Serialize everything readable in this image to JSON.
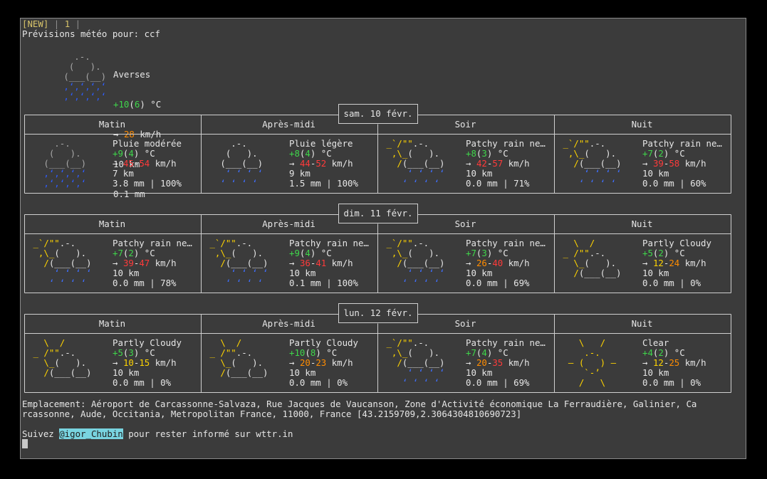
{
  "tabbar": {
    "tab_new": "[NEW]",
    "tab_num": "1"
  },
  "header": "Prévisions météo pour: ccf",
  "current": {
    "desc": "Averses",
    "temp": "+10",
    "feels": "6",
    "temp_unit": "°C",
    "wind_arrow": "→",
    "wind": "28",
    "wind_unit": "km/h",
    "visibility": "10 km",
    "precip": "0.1 mm",
    "icon": "rain-showers-icon"
  },
  "period_labels": [
    "Matin",
    "Après-midi",
    "Soir",
    "Nuit"
  ],
  "days": [
    {
      "date": "sam. 10 févr.",
      "periods": [
        {
          "icon": "rain-showers-icon",
          "desc": "Pluie modérée",
          "temp": "+9",
          "feels": "4",
          "wind_lo": "45",
          "wind_hi": "54",
          "wind_lo_color": "#ff3a3a",
          "wind_hi_color": "#ff3a3a",
          "visibility": "7 km",
          "precip": "3.8 mm | 100%"
        },
        {
          "icon": "light-rain-icon",
          "desc": "Pluie légère",
          "temp": "+8",
          "feels": "4",
          "wind_lo": "44",
          "wind_hi": "52",
          "wind_lo_color": "#ff3a3a",
          "wind_hi_color": "#ff3a3a",
          "visibility": "9 km",
          "precip": "1.5 mm | 100%"
        },
        {
          "icon": "patchy-rain-icon",
          "desc": "Patchy rain ne…",
          "temp": "+8",
          "feels": "3",
          "wind_lo": "42",
          "wind_hi": "57",
          "wind_lo_color": "#ff3a3a",
          "wind_hi_color": "#ff3a3a",
          "visibility": "10 km",
          "precip": "0.0 mm | 71%"
        },
        {
          "icon": "patchy-rain-icon",
          "desc": "Patchy rain ne…",
          "temp": "+7",
          "feels": "2",
          "wind_lo": "39",
          "wind_hi": "58",
          "wind_lo_color": "#ff3a3a",
          "wind_hi_color": "#ff3a3a",
          "visibility": "10 km",
          "precip": "0.0 mm | 60%"
        }
      ]
    },
    {
      "date": "dim. 11 févr.",
      "periods": [
        {
          "icon": "patchy-rain-icon",
          "desc": "Patchy rain ne…",
          "temp": "+7",
          "feels": "2",
          "wind_lo": "39",
          "wind_hi": "47",
          "wind_lo_color": "#ff3a3a",
          "wind_hi_color": "#ff3a3a",
          "visibility": "10 km",
          "precip": "0.0 mm | 78%"
        },
        {
          "icon": "patchy-rain-icon",
          "desc": "Patchy rain ne…",
          "temp": "+9",
          "feels": "4",
          "wind_lo": "36",
          "wind_hi": "41",
          "wind_lo_color": "#ff3a3a",
          "wind_hi_color": "#ff3a3a",
          "visibility": "10 km",
          "precip": "0.1 mm | 100%"
        },
        {
          "icon": "patchy-rain-icon",
          "desc": "Patchy rain ne…",
          "temp": "+7",
          "feels": "3",
          "wind_lo": "26",
          "wind_hi": "40",
          "wind_lo_color": "#ff8c00",
          "wind_hi_color": "#ff3a3a",
          "visibility": "10 km",
          "precip": "0.0 mm | 69%"
        },
        {
          "icon": "partly-cloudy-icon",
          "desc": "Partly Cloudy",
          "temp": "+5",
          "feels": "2",
          "wind_lo": "12",
          "wind_hi": "24",
          "wind_lo_color": "#ffd400",
          "wind_hi_color": "#ff8c00",
          "visibility": "10 km",
          "precip": "0.0 mm | 0%"
        }
      ]
    },
    {
      "date": "lun. 12 févr.",
      "periods": [
        {
          "icon": "partly-cloudy-icon",
          "desc": "Partly Cloudy",
          "temp": "+5",
          "feels": "3",
          "wind_lo": "10",
          "wind_hi": "15",
          "wind_lo_color": "#ffd400",
          "wind_hi_color": "#ffd400",
          "visibility": "10 km",
          "precip": "0.0 mm | 0%"
        },
        {
          "icon": "partly-cloudy-icon",
          "desc": "Partly Cloudy",
          "temp": "+10",
          "feels": "8",
          "wind_lo": "20",
          "wind_hi": "23",
          "wind_lo_color": "#ff8c00",
          "wind_hi_color": "#ff8c00",
          "visibility": "10 km",
          "precip": "0.0 mm | 0%"
        },
        {
          "icon": "patchy-rain-icon",
          "desc": "Patchy rain ne…",
          "temp": "+7",
          "feels": "4",
          "wind_lo": "20",
          "wind_hi": "35",
          "wind_lo_color": "#ff8c00",
          "wind_hi_color": "#ff3a3a",
          "visibility": "10 km",
          "precip": "0.0 mm | 69%"
        },
        {
          "icon": "sun-icon",
          "desc": "Clear",
          "temp": "+4",
          "feels": "2",
          "wind_lo": "12",
          "wind_hi": "25",
          "wind_lo_color": "#ffd400",
          "wind_hi_color": "#ff8c00",
          "visibility": "10 km",
          "precip": "0.0 mm | 0%"
        }
      ]
    }
  ],
  "location_line1": "Emplacement: Aéroport de Carcassonne-Salvaza, Rue Jacques de Vaucanson, Zone d'Activité économique La Ferraudière, Galinier, Ca",
  "location_line2": "rcassonne, Aude, Occitania, Metropolitan France, 11000, France [43.2159709,2.3064304810690723]",
  "follow_prefix": "Suivez ",
  "follow_handle": "@igor_Chubin",
  "follow_suffix": " pour rester informé sur wttr.in"
}
